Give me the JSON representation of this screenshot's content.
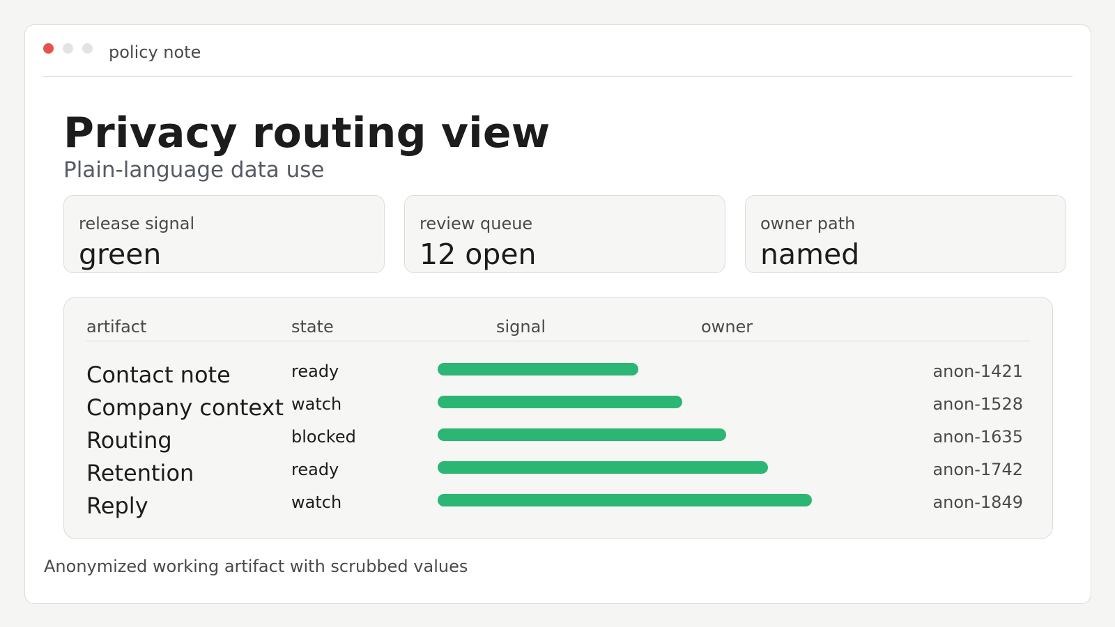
{
  "window": {
    "title": "policy note",
    "controls": [
      {
        "name": "close",
        "color": "#e5534b"
      },
      {
        "name": "minimize",
        "color": "#e3e3e1"
      },
      {
        "name": "maximize",
        "color": "#e3e3e1"
      }
    ]
  },
  "header": {
    "title": "Privacy routing view",
    "subtitle": "Plain-language data use"
  },
  "cards": [
    {
      "label": "release signal",
      "value": "green"
    },
    {
      "label": "review queue",
      "value": "12 open"
    },
    {
      "label": "owner path",
      "value": "named"
    }
  ],
  "table": {
    "columns": [
      "artifact",
      "state",
      "signal",
      "owner"
    ],
    "bar_color": "#2bb673",
    "rows": [
      {
        "artifact": "Contact note",
        "state": "ready",
        "signal": 0.48,
        "owner": "anon-1421"
      },
      {
        "artifact": "Company context",
        "state": "watch",
        "signal": 0.585,
        "owner": "anon-1528"
      },
      {
        "artifact": "Routing",
        "state": "blocked",
        "signal": 0.69,
        "owner": "anon-1635"
      },
      {
        "artifact": "Retention",
        "state": "ready",
        "signal": 0.79,
        "owner": "anon-1742"
      },
      {
        "artifact": "Reply",
        "state": "watch",
        "signal": 0.895,
        "owner": "anon-1849"
      }
    ]
  },
  "footer": {
    "note": "Anonymized working artifact with scrubbed values"
  }
}
